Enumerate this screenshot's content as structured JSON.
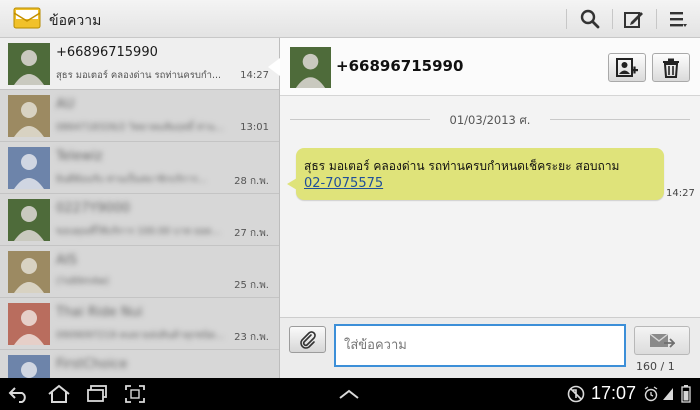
{
  "app": {
    "title": "ข้อความ",
    "icon": "envelope-icon"
  },
  "actionbar": {
    "buttons": [
      {
        "name": "search-button",
        "icon": "search-icon"
      },
      {
        "name": "compose-button",
        "icon": "compose-icon"
      },
      {
        "name": "menu-button",
        "icon": "menu-icon"
      }
    ]
  },
  "threads": [
    {
      "name": "+66896715990",
      "snippet": "สุธร มอเตอร์ คลองด่าน รถท่านครบกำ...",
      "time": "14:27",
      "selected": true,
      "avatar_color": "#4e6b3a"
    },
    {
      "name": "AU",
      "snippet": "0864718326/2 วิทยาคมสัมฤทธิ์ ท่าน...",
      "time": "13:01",
      "selected": false,
      "avatar_color": "#9c8a62"
    },
    {
      "name": "Telewiz",
      "snippet": "ยินดีต้อนรับ ท่านเป็นสมาชิกบริการ...",
      "time": "28 ก.พ.",
      "selected": false,
      "avatar_color": "#6d84aa"
    },
    {
      "name": "0227Y9000",
      "snippet": "ขอบคุณที่ใช้บริการ 100.00 บาท ยอด...",
      "time": "27 ก.พ.",
      "selected": false,
      "avatar_color": "#4e6b3a"
    },
    {
      "name": "AIS",
      "snippet": "(?x89m4w)",
      "time": "25 ก.พ.",
      "selected": false,
      "avatar_color": "#9c8a62"
    },
    {
      "name": "Thai Ride Nui",
      "snippet": "0909097219 คนขายส่งสินค้าทุกชนิด...",
      "time": "23 ก.พ.",
      "selected": false,
      "avatar_color": "#b96d5e"
    },
    {
      "name": "FirstChoice",
      "snippet": "",
      "time": "",
      "selected": false,
      "avatar_color": "#6d84aa"
    }
  ],
  "conversation": {
    "contact": "+66896715990",
    "add_contact_icon": "add-contact-icon",
    "delete_icon": "trash-icon",
    "date_divider": "01/03/2013 ศ.",
    "message": {
      "text": "สุธร มอเตอร์ คลองด่าน รถท่านครบกำหนดเช็คระยะ สอบถาม",
      "phone_link": "02-7075575",
      "time": "14:27",
      "bubble_color": "#dfe37a"
    }
  },
  "compose": {
    "attach_icon": "paperclip-icon",
    "placeholder": "ใส่ข้อความ",
    "send_icon": "send-icon",
    "counter": "160 / 1",
    "input_border_color": "#3c8fd8"
  },
  "navbar": {
    "clock": "17:07",
    "buttons": [
      "back-icon",
      "home-icon",
      "recent-apps-icon",
      "screenshot-icon",
      "collapse-icon"
    ],
    "status_icons": [
      "no-sync-icon",
      "alarm-icon",
      "signal-icon",
      "battery-icon"
    ]
  }
}
